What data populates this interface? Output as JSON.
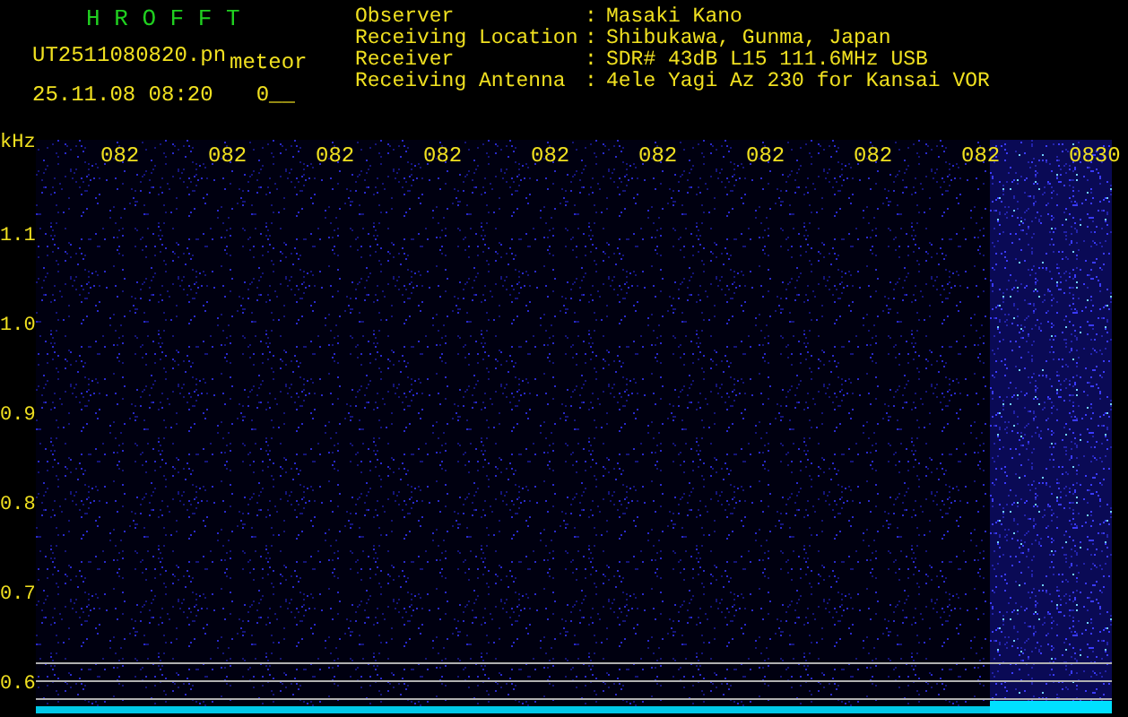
{
  "app_title": "H R O F F T",
  "file_name": "UT2511080820.pn",
  "tag": "meteor",
  "timestamp": "25.11.08 08:20",
  "count": "0__",
  "station_info": [
    {
      "label": "Observer",
      "separator": ":",
      "value": "Masaki Kano"
    },
    {
      "label": "Receiving Location",
      "separator": ":",
      "value": "Shibukawa, Gunma, Japan"
    },
    {
      "label": "Receiver",
      "separator": ":",
      "value": "SDR# 43dB L15 111.6MHz USB"
    },
    {
      "label": "Receiving Antenna",
      "separator": ":",
      "value": "4ele Yagi Az 230 for Kansai VOR"
    }
  ],
  "y_axis": {
    "unit": "kHz",
    "ticks": [
      "1.1",
      "1.0",
      "0.9",
      "0.8",
      "0.7",
      "0.6"
    ]
  },
  "time_labels": [
    "082",
    "082",
    "082",
    "082",
    "082",
    "082",
    "082",
    "082",
    "082",
    "0830"
  ]
}
